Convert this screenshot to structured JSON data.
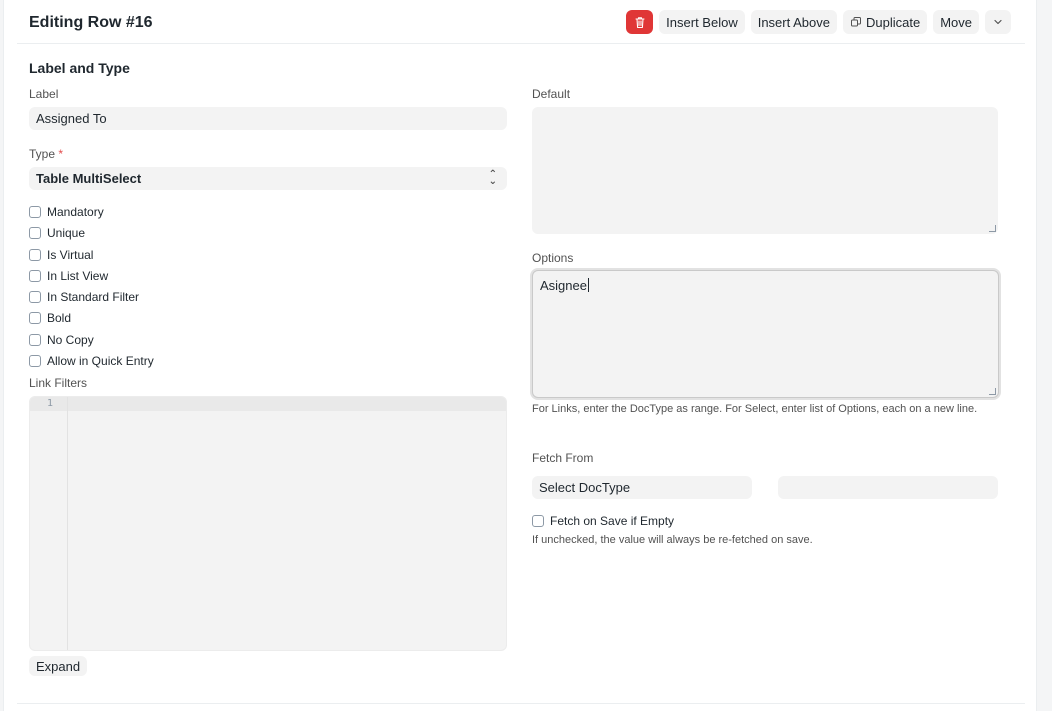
{
  "header": {
    "title": "Editing Row #16",
    "delete_icon": "trash-icon",
    "insert_below": "Insert Below",
    "insert_above": "Insert Above",
    "duplicate": "Duplicate",
    "duplicate_icon": "copy-icon",
    "move": "Move",
    "more_icon": "chevron-down-icon"
  },
  "section": {
    "title": "Label and Type"
  },
  "fields": {
    "label": {
      "label": "Label",
      "value": "Assigned To"
    },
    "type": {
      "label": "Type",
      "required_mark": "*",
      "value": "Table MultiSelect"
    },
    "link_filters": {
      "label": "Link Filters",
      "line_number": "1"
    },
    "expand_button": "Expand",
    "default": {
      "label": "Default",
      "value": ""
    },
    "options": {
      "label": "Options",
      "value": "Asignee",
      "help": "For Links, enter the DocType as range. For Select, enter list of Options, each on a new line."
    },
    "fetch_from": {
      "label": "Fetch From",
      "doctype_placeholder": "Select DocType",
      "field_value": ""
    },
    "fetch_if_empty": {
      "label": "Fetch on Save if Empty",
      "help": "If unchecked, the value will always be re-fetched on save."
    }
  },
  "checkboxes": [
    {
      "label": "Mandatory",
      "checked": false
    },
    {
      "label": "Unique",
      "checked": false
    },
    {
      "label": "Is Virtual",
      "checked": false
    },
    {
      "label": "In List View",
      "checked": false
    },
    {
      "label": "In Standard Filter",
      "checked": false
    },
    {
      "label": "Bold",
      "checked": false
    },
    {
      "label": "No Copy",
      "checked": false
    },
    {
      "label": "Allow in Quick Entry",
      "checked": false
    }
  ],
  "colors": {
    "danger": "#e03636",
    "field_bg": "#f3f3f3",
    "text": "#1f272e",
    "muted": "#525252"
  }
}
